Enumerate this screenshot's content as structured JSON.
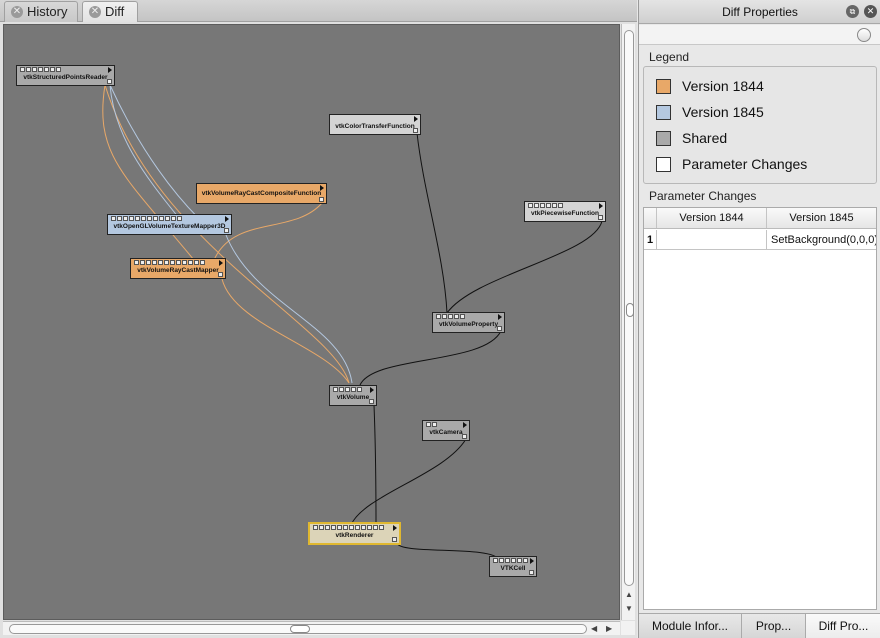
{
  "tabs": [
    {
      "label": "History"
    },
    {
      "label": "Diff"
    }
  ],
  "modules": [
    {
      "label": "vtkStructuredPointsReader"
    },
    {
      "label": "vtkColorTransferFunction"
    },
    {
      "label": "vtkVolumeRayCastCompositeFunction"
    },
    {
      "label": "vtkPiecewiseFunction"
    },
    {
      "label": "vtkOpenGLVolumeTextureMapper3D"
    },
    {
      "label": "vtkVolumeRayCastMapper"
    },
    {
      "label": "vtkVolumeProperty"
    },
    {
      "label": "vtkVolume"
    },
    {
      "label": "vtkCamera"
    },
    {
      "label": "vtkRenderer"
    },
    {
      "label": "VTKCell"
    }
  ],
  "colors": {
    "version_a": "#e8a868",
    "version_b": "#b4c8e0",
    "shared": "#a9a9a9",
    "selected_border": "#e0b830"
  },
  "panel": {
    "title": "Diff Properties",
    "float_icon": "float-icon",
    "close_icon": "close-icon",
    "legend_label": "Legend",
    "legend": [
      {
        "label": "Version 1844",
        "color": "#e8a868"
      },
      {
        "label": "Version 1845",
        "color": "#b4c8e0"
      },
      {
        "label": "Shared",
        "color": "#a9a9a9"
      },
      {
        "label": "Parameter Changes",
        "color": "#ffffff"
      }
    ],
    "param_label": "Parameter Changes",
    "table": {
      "columns": [
        "Version 1844",
        "Version 1845"
      ],
      "rows": [
        {
          "index": "1",
          "v1844": "",
          "v1845": "SetBackground(0,0,0)"
        }
      ]
    },
    "bottom_tabs": [
      "Module Infor...",
      "Prop...",
      "Diff Pro..."
    ]
  }
}
